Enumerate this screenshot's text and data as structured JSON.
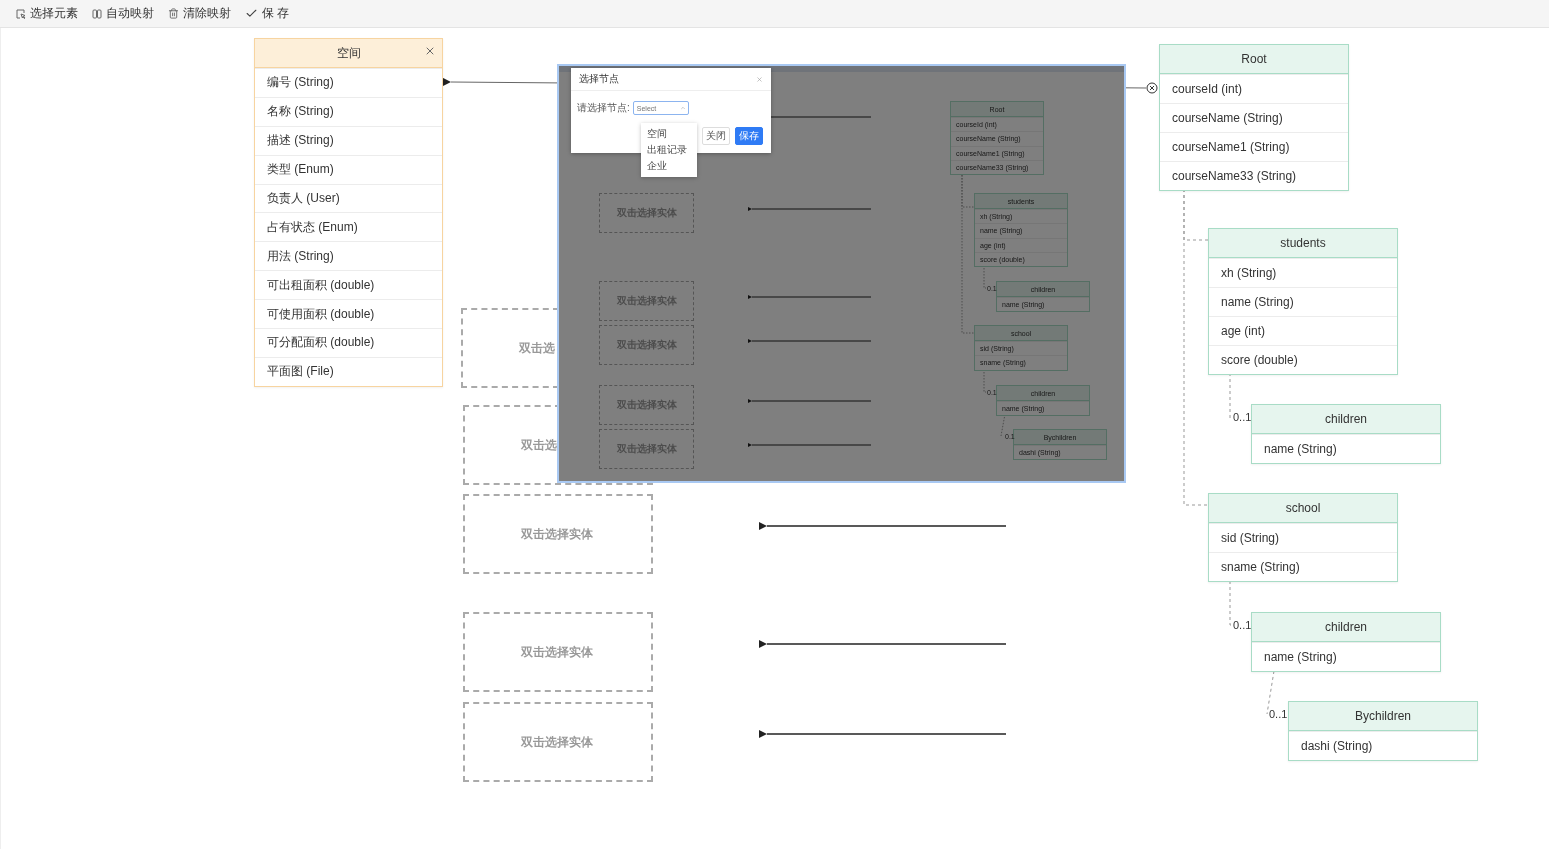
{
  "toolbar": [
    {
      "kind": "select",
      "label": "选择元素"
    },
    {
      "kind": "auto-map",
      "label": "自动映射"
    },
    {
      "kind": "clear",
      "label": "清除映射"
    },
    {
      "kind": "save",
      "label": "保 存"
    }
  ],
  "source_entity": {
    "title": "空间",
    "fields": [
      "编号 (String)",
      "名称 (String)",
      "描述 (String)",
      "类型 (Enum)",
      "负责人 (User)",
      "占有状态 (Enum)",
      "用法 (String)",
      "可出租面积 (double)",
      "可使用面积 (double)",
      "可分配面积 (double)",
      "平面图 (File)"
    ]
  },
  "target_slots": [
    {
      "label": "双击选"
    },
    {
      "label": "双击选"
    },
    {
      "label": "双击选择实体"
    },
    {
      "label": "双击选择实体"
    },
    {
      "label": "双击选择实体"
    }
  ],
  "target_tree": {
    "title": "Root",
    "fields": [
      "courseId (int)",
      "courseName (String)",
      "courseName1 (String)",
      "courseName33 (String)"
    ],
    "children": [
      {
        "title": "students",
        "fields": [
          "xh (String)",
          "name (String)",
          "age (int)",
          "score (double)"
        ],
        "children": [
          {
            "title": "children",
            "multiplicity": "0..1",
            "fields": [
              "name (String)"
            ]
          }
        ]
      },
      {
        "title": "school",
        "fields": [
          "sid (String)",
          "sname (String)"
        ],
        "children": [
          {
            "title": "children",
            "multiplicity": "0..1",
            "fields": [
              "name (String)"
            ],
            "children": [
              {
                "title": "Bychildren",
                "multiplicity": "0..1",
                "fields": [
                  "dashi (String)"
                ]
              }
            ]
          }
        ]
      }
    ]
  },
  "inset_screenshot": {
    "dialog": {
      "title": "选择节点",
      "field_label": "请选择节点:",
      "placeholder": "Select",
      "options": [
        "空间",
        "出租记录",
        "企业"
      ],
      "buttons": [
        {
          "kind": "default",
          "label": "关闭"
        },
        {
          "kind": "primary",
          "label": "保存"
        }
      ]
    },
    "slots": [
      "双击选择实体",
      "双击选择实体",
      "双击选择实体",
      "双击选择实体",
      "双击选择实体"
    ],
    "tree": {
      "title": "Root",
      "fields": [
        "courseId (int)",
        "courseName (String)",
        "courseName1 (String)",
        "courseName33 (String)"
      ],
      "children": [
        {
          "title": "students",
          "fields": [
            "xh (String)",
            "name (String)",
            "age (int)",
            "score (double)"
          ],
          "children": [
            {
              "title": "children",
              "multiplicity": "0.1",
              "fields": [
                "name (String)"
              ]
            }
          ]
        },
        {
          "title": "school",
          "fields": [
            "sid (String)",
            "sname (String)"
          ],
          "children": [
            {
              "title": "children",
              "multiplicity": "0.1",
              "fields": [
                "name (String)"
              ],
              "children": [
                {
                  "title": "Bychildren",
                  "multiplicity": "0.1",
                  "fields": [
                    "dashi (String)"
                  ]
                }
              ]
            }
          ]
        }
      ]
    }
  }
}
